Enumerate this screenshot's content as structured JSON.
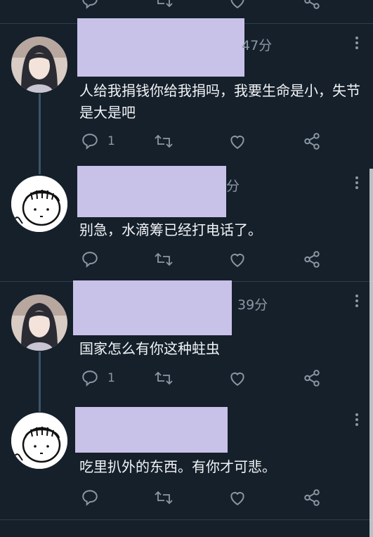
{
  "tweets": [
    {
      "time": "47分",
      "text": "人给我捐钱你给我捐吗，我要生命是小，失节是大是吧",
      "reply_count": "1",
      "avatar": "girl-photo-avatar"
    },
    {
      "time": "分",
      "text": "别急，水滴筹已经打电话了。",
      "reply_count": "",
      "avatar": "cartoon-face-avatar"
    },
    {
      "time": "39分",
      "text": "国家怎么有你这种蛀虫",
      "reply_count": "1",
      "avatar": "girl-photo-avatar"
    },
    {
      "time": "",
      "text": "吃里扒外的东西。有你才可悲。",
      "reply_count": "",
      "avatar": "cartoon-face-avatar"
    }
  ],
  "colors": {
    "background": "#15202b",
    "redaction": "#c8c1e8",
    "muted": "#8b98a5",
    "thread_line": "#3d5466"
  },
  "icons": [
    "reply-icon",
    "retweet-icon",
    "like-icon",
    "share-icon",
    "more-icon"
  ]
}
